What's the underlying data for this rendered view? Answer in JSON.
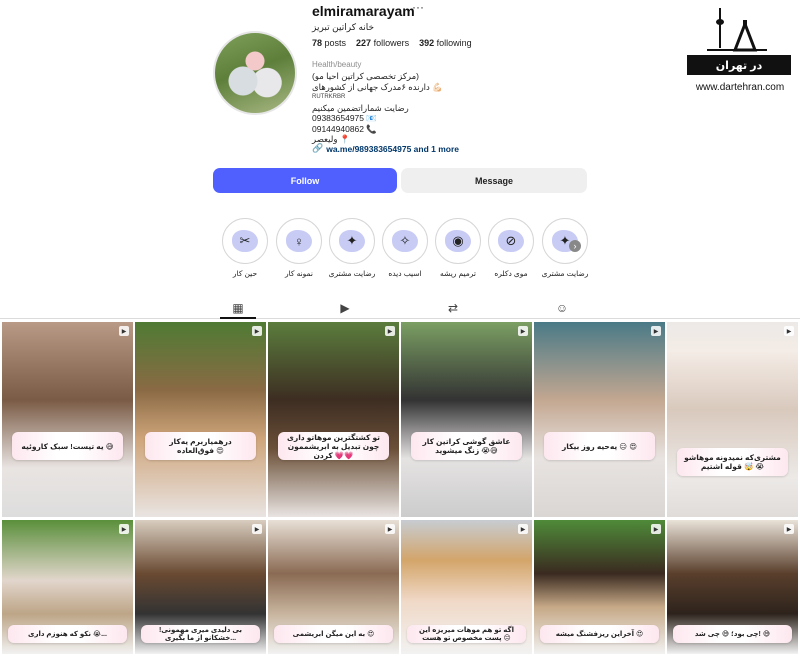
{
  "profile": {
    "username": "elmiramarayam",
    "more": "···",
    "fullname": "خانه کراتین تبریز",
    "stats": {
      "posts_count": "78",
      "posts_label": "posts",
      "followers_count": "227",
      "followers_label": "followers",
      "following_count": "392",
      "following_label": "following"
    },
    "category": "Health/beauty",
    "bio": [
      "(مرکز تخصصی کراتین احیا مو)",
      "دارنده ۶مدرک جهانی از کشورهای 💪🏻",
      "RUTRKRBR",
      "رضایت شمارا‌تضمین میکنیم",
      "09383654975 📧",
      "09144940862 📞",
      "ولیعصر 📍"
    ],
    "link_text": "wa.me/989383654975 and 1 more",
    "link_icon": "link-icon"
  },
  "buttons": {
    "follow": "Follow",
    "message": "Message"
  },
  "logo": {
    "banner_text": "در تهران",
    "url": "www.dartehran.com"
  },
  "highlights": [
    {
      "label": "رضایت مشتری",
      "icon": "stars-person-icon",
      "glyph": "✦"
    },
    {
      "label": "موی دکلره",
      "icon": "no-hair-icon",
      "glyph": "⊘"
    },
    {
      "label": "ترمیم ریشه",
      "icon": "hair-root-icon",
      "glyph": "◉"
    },
    {
      "label": "اسیب دیده",
      "icon": "magic-wand-icon",
      "glyph": "✧"
    },
    {
      "label": "رضایت مشتری",
      "icon": "stars-person-icon",
      "glyph": "✦"
    },
    {
      "label": "نمونه کار",
      "icon": "woman-hair-icon",
      "glyph": "♀"
    },
    {
      "label": "حین کار",
      "icon": "hair-treatment-icon",
      "glyph": "✂"
    }
  ],
  "tabs": [
    {
      "name": "posts-grid-icon",
      "glyph": "▦"
    },
    {
      "name": "reels-icon",
      "glyph": "▶"
    },
    {
      "name": "reposts-icon",
      "glyph": "⇄"
    },
    {
      "name": "tagged-icon",
      "glyph": "☺"
    }
  ],
  "posts": [
    {
      "caption": "یه تیست! سبک کاروئیه 😅"
    },
    {
      "caption": "درهمیاربرم یه‌کار فوق‌العاده 😍"
    },
    {
      "caption": "تو کشتگترین موهاتو داری چون تبدیل به ابریشممون کردن 💗💗"
    },
    {
      "caption": "عاشق گوشی کراتین کار زنگ میشوید 😭😅"
    },
    {
      "caption": "یه‌حیه روز بیکار 😑 😍"
    },
    {
      "caption": "مشتری‌که نمیدونه موهاشو قوله اشتیم 🤯 😭"
    },
    {
      "caption": "نکو که هنوزم داری 😭..."
    },
    {
      "caption": "بی دلیدی میری مهمونی! خشکانو از ما بگیری..."
    },
    {
      "caption": "به این میگن ابریشمی 😍"
    },
    {
      "caption": "اگه تو هم موهات میریزه این پست مخصوص تو هست 😔"
    },
    {
      "caption": "آخراین ریزفشنگ میشه 😍"
    },
    {
      "caption": "چی بود؛ 😅 چی شد! 😅"
    }
  ]
}
